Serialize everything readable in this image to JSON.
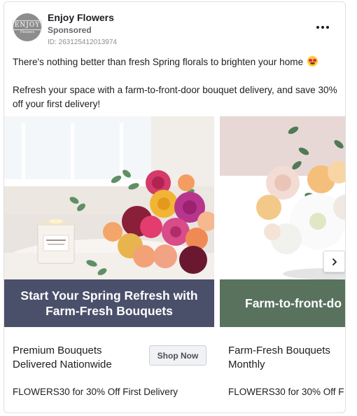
{
  "post": {
    "page_name": "Enjoy Flowers",
    "sponsored_label": "Sponsored",
    "ad_id": "ID: 263125412013974",
    "avatar_logo": "ENJOY",
    "avatar_logo_sub": "Flowers",
    "primary_text_line1": "There's nothing better than fresh Spring florals to brighten your home",
    "primary_text_line2": "Refresh your space with a farm-to-front-door bouquet delivery, and save 30% off your first delivery!"
  },
  "carousel": {
    "cards": [
      {
        "image_icon": "flower-bouquet-with-candle",
        "banner_text": "Start Your Spring Refresh with Farm-Fresh Bouquets",
        "headline": "Premium Bouquets Delivered Nationwide",
        "cta_label": "Shop Now",
        "description": "FLOWERS30 for 30% Off First Delivery"
      },
      {
        "image_icon": "white-flower-bouquet",
        "banner_text": "Farm-to-front-do",
        "headline": "Farm-Fresh Bouquets Monthly",
        "description": "FLOWERS30 for 30% Off F"
      }
    ],
    "next_icon": "chevron-right-icon"
  },
  "colors": {
    "banner_1": "#4a4f6a",
    "banner_2": "#58725e",
    "button_bg": "#f0f2f5"
  }
}
